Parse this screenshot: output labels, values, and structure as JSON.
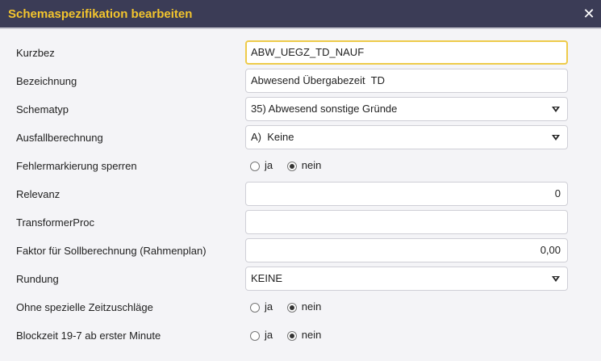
{
  "dialog": {
    "title": "Schemaspezifikation bearbeiten",
    "close_symbol": "✕"
  },
  "fields": {
    "kurzbez": {
      "label": "Kurzbez",
      "value": "ABW_UEGZ_TD_NAUF"
    },
    "bezeichnung": {
      "label": "Bezeichnung",
      "value": "Abwesend Übergabezeit  TD"
    },
    "schematyp": {
      "label": "Schematyp",
      "value": "35) Abwesend sonstige Gründe"
    },
    "ausfallberechnung": {
      "label": "Ausfallberechnung",
      "value": "A)  Keine"
    },
    "fehlermarkierung": {
      "label": "Fehlermarkierung sperren",
      "options": [
        "ja",
        "nein"
      ],
      "selected": "nein"
    },
    "relevanz": {
      "label": "Relevanz",
      "value": "0"
    },
    "transformerproc": {
      "label": "TransformerProc",
      "value": ""
    },
    "faktor": {
      "label": "Faktor für Sollberechnung (Rahmenplan)",
      "value": "0,00"
    },
    "rundung": {
      "label": "Rundung",
      "value": "KEINE"
    },
    "zeitzuschlaege": {
      "label": "Ohne spezielle Zeitzuschläge",
      "options": [
        "ja",
        "nein"
      ],
      "selected": "nein"
    },
    "blockzeit": {
      "label": "Blockzeit 19-7 ab erster Minute",
      "options": [
        "ja",
        "nein"
      ],
      "selected": "nein"
    }
  },
  "colors": {
    "titlebar_bg": "#3b3c56",
    "title_text": "#f3c52d",
    "focus_border": "#eecb4a",
    "body_bg": "#f4f4f7"
  },
  "icons": {
    "close": "close-icon",
    "dropdown": "chevron-down-icon"
  }
}
